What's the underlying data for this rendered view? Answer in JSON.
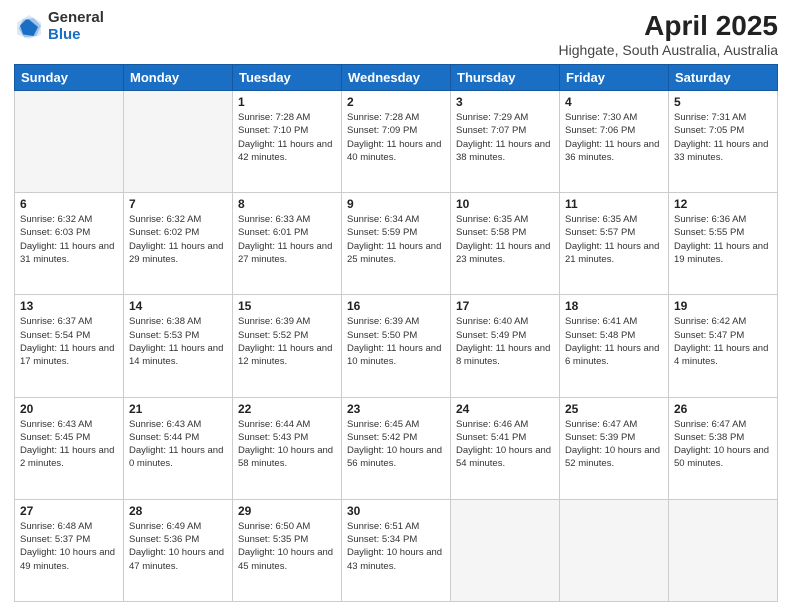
{
  "logo": {
    "general": "General",
    "blue": "Blue"
  },
  "title": "April 2025",
  "subtitle": "Highgate, South Australia, Australia",
  "days_of_week": [
    "Sunday",
    "Monday",
    "Tuesday",
    "Wednesday",
    "Thursday",
    "Friday",
    "Saturday"
  ],
  "weeks": [
    [
      {
        "day": "",
        "info": ""
      },
      {
        "day": "",
        "info": ""
      },
      {
        "day": "1",
        "info": "Sunrise: 7:28 AM\nSunset: 7:10 PM\nDaylight: 11 hours and 42 minutes."
      },
      {
        "day": "2",
        "info": "Sunrise: 7:28 AM\nSunset: 7:09 PM\nDaylight: 11 hours and 40 minutes."
      },
      {
        "day": "3",
        "info": "Sunrise: 7:29 AM\nSunset: 7:07 PM\nDaylight: 11 hours and 38 minutes."
      },
      {
        "day": "4",
        "info": "Sunrise: 7:30 AM\nSunset: 7:06 PM\nDaylight: 11 hours and 36 minutes."
      },
      {
        "day": "5",
        "info": "Sunrise: 7:31 AM\nSunset: 7:05 PM\nDaylight: 11 hours and 33 minutes."
      }
    ],
    [
      {
        "day": "6",
        "info": "Sunrise: 6:32 AM\nSunset: 6:03 PM\nDaylight: 11 hours and 31 minutes."
      },
      {
        "day": "7",
        "info": "Sunrise: 6:32 AM\nSunset: 6:02 PM\nDaylight: 11 hours and 29 minutes."
      },
      {
        "day": "8",
        "info": "Sunrise: 6:33 AM\nSunset: 6:01 PM\nDaylight: 11 hours and 27 minutes."
      },
      {
        "day": "9",
        "info": "Sunrise: 6:34 AM\nSunset: 5:59 PM\nDaylight: 11 hours and 25 minutes."
      },
      {
        "day": "10",
        "info": "Sunrise: 6:35 AM\nSunset: 5:58 PM\nDaylight: 11 hours and 23 minutes."
      },
      {
        "day": "11",
        "info": "Sunrise: 6:35 AM\nSunset: 5:57 PM\nDaylight: 11 hours and 21 minutes."
      },
      {
        "day": "12",
        "info": "Sunrise: 6:36 AM\nSunset: 5:55 PM\nDaylight: 11 hours and 19 minutes."
      }
    ],
    [
      {
        "day": "13",
        "info": "Sunrise: 6:37 AM\nSunset: 5:54 PM\nDaylight: 11 hours and 17 minutes."
      },
      {
        "day": "14",
        "info": "Sunrise: 6:38 AM\nSunset: 5:53 PM\nDaylight: 11 hours and 14 minutes."
      },
      {
        "day": "15",
        "info": "Sunrise: 6:39 AM\nSunset: 5:52 PM\nDaylight: 11 hours and 12 minutes."
      },
      {
        "day": "16",
        "info": "Sunrise: 6:39 AM\nSunset: 5:50 PM\nDaylight: 11 hours and 10 minutes."
      },
      {
        "day": "17",
        "info": "Sunrise: 6:40 AM\nSunset: 5:49 PM\nDaylight: 11 hours and 8 minutes."
      },
      {
        "day": "18",
        "info": "Sunrise: 6:41 AM\nSunset: 5:48 PM\nDaylight: 11 hours and 6 minutes."
      },
      {
        "day": "19",
        "info": "Sunrise: 6:42 AM\nSunset: 5:47 PM\nDaylight: 11 hours and 4 minutes."
      }
    ],
    [
      {
        "day": "20",
        "info": "Sunrise: 6:43 AM\nSunset: 5:45 PM\nDaylight: 11 hours and 2 minutes."
      },
      {
        "day": "21",
        "info": "Sunrise: 6:43 AM\nSunset: 5:44 PM\nDaylight: 11 hours and 0 minutes."
      },
      {
        "day": "22",
        "info": "Sunrise: 6:44 AM\nSunset: 5:43 PM\nDaylight: 10 hours and 58 minutes."
      },
      {
        "day": "23",
        "info": "Sunrise: 6:45 AM\nSunset: 5:42 PM\nDaylight: 10 hours and 56 minutes."
      },
      {
        "day": "24",
        "info": "Sunrise: 6:46 AM\nSunset: 5:41 PM\nDaylight: 10 hours and 54 minutes."
      },
      {
        "day": "25",
        "info": "Sunrise: 6:47 AM\nSunset: 5:39 PM\nDaylight: 10 hours and 52 minutes."
      },
      {
        "day": "26",
        "info": "Sunrise: 6:47 AM\nSunset: 5:38 PM\nDaylight: 10 hours and 50 minutes."
      }
    ],
    [
      {
        "day": "27",
        "info": "Sunrise: 6:48 AM\nSunset: 5:37 PM\nDaylight: 10 hours and 49 minutes."
      },
      {
        "day": "28",
        "info": "Sunrise: 6:49 AM\nSunset: 5:36 PM\nDaylight: 10 hours and 47 minutes."
      },
      {
        "day": "29",
        "info": "Sunrise: 6:50 AM\nSunset: 5:35 PM\nDaylight: 10 hours and 45 minutes."
      },
      {
        "day": "30",
        "info": "Sunrise: 6:51 AM\nSunset: 5:34 PM\nDaylight: 10 hours and 43 minutes."
      },
      {
        "day": "",
        "info": ""
      },
      {
        "day": "",
        "info": ""
      },
      {
        "day": "",
        "info": ""
      }
    ]
  ]
}
